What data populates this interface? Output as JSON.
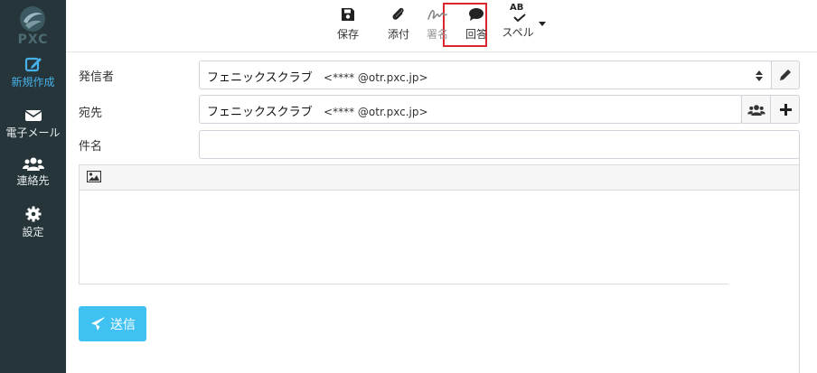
{
  "sidebar": {
    "logo_text": "PXC",
    "items": [
      {
        "label": "新規作成",
        "icon": "compose-icon",
        "active": true
      },
      {
        "label": "電子メール",
        "icon": "envelope-icon",
        "active": false
      },
      {
        "label": "連絡先",
        "icon": "contacts-icon",
        "active": false
      },
      {
        "label": "設定",
        "icon": "gear-icon",
        "active": false
      }
    ]
  },
  "toolbar": {
    "save": "保存",
    "attach": "添付",
    "signature": "署名",
    "reply": "回答",
    "spell": "スペル",
    "spell_icon_text": "AB"
  },
  "form": {
    "from_label": "発信者",
    "from_name": "フェニックスクラブ",
    "from_addr": "<****  @otr.pxc.jp>",
    "to_label": "宛先",
    "to_name": "フェニックスクラブ",
    "to_addr": "<****  @otr.pxc.jp>",
    "subject_label": "件名",
    "subject_value": ""
  },
  "send_button": "送信",
  "colors": {
    "sidebar_bg": "#26353a",
    "accent": "#47b0e8",
    "send_bg": "#3fc1f2",
    "highlight": "#d9262f"
  }
}
